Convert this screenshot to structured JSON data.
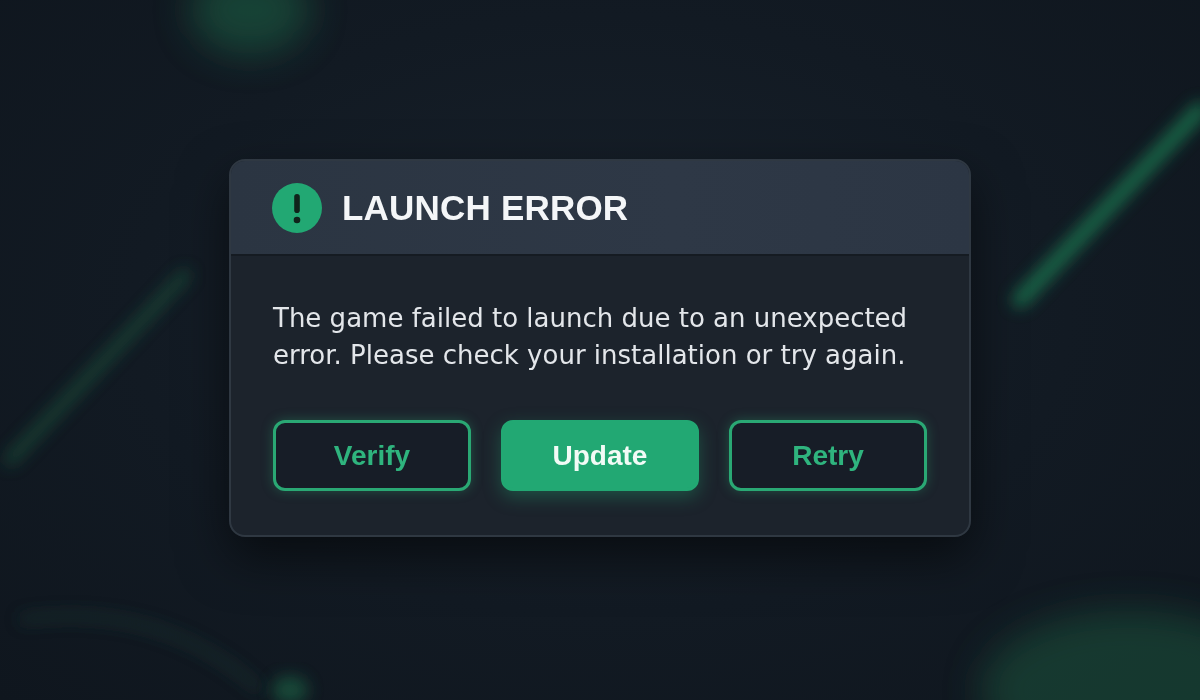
{
  "dialog": {
    "title": "LAUNCH ERROR",
    "message": "The game failed to launch due to an unexpected error. Please check your installation or try again.",
    "buttons": [
      {
        "label": "Verify",
        "kind": "outline"
      },
      {
        "label": "Update",
        "kind": "primary"
      },
      {
        "label": "Retry",
        "kind": "outline"
      }
    ]
  }
}
